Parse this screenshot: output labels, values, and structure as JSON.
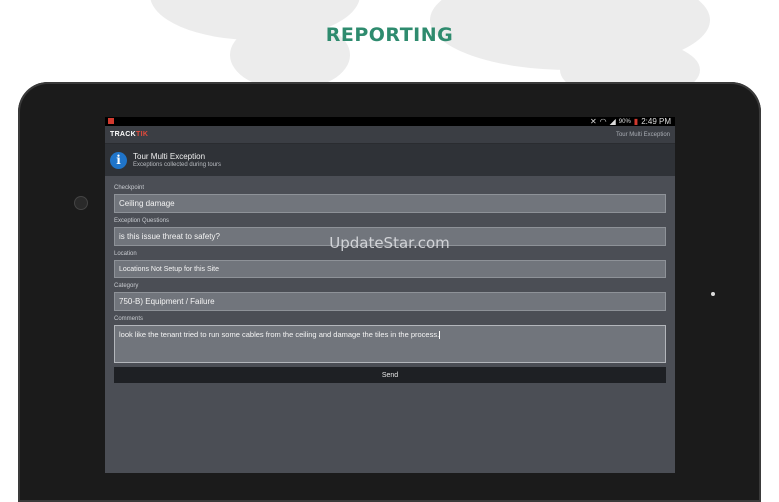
{
  "page": {
    "heading": "REPORTING",
    "watermark": "UpdateStar.com"
  },
  "statusbar": {
    "icons": [
      "mute-icon",
      "wifi-icon",
      "signal-icon",
      "battery-icon"
    ],
    "battery": "90%",
    "time": "2:49 PM"
  },
  "appbar": {
    "logo_prefix": "TRACK",
    "logo_suffix": "TIK",
    "title": "Tour Multi Exception"
  },
  "header": {
    "icon": "info-icon",
    "title": "Tour Multi Exception",
    "subtitle": "Exceptions collected during tours"
  },
  "form": {
    "checkpoint_label": "Checkpoint",
    "checkpoint_value": "Ceiling damage",
    "exception_label": "Exception Questions",
    "exception_value": "is this issue threat to safety?",
    "location_label": "Location",
    "location_value": "Locations Not Setup for this Site",
    "category_label": "Category",
    "category_value": "750-B) Equipment / Failure",
    "comments_label": "Comments",
    "comments_value": "look like the tenant tried to run some cables from the ceiling and damage the tiles in the process.",
    "send_label": "Send"
  },
  "colors": {
    "heading": "#2e8b6e",
    "accent": "#1f74c9",
    "logo_red": "#e24a3b"
  }
}
